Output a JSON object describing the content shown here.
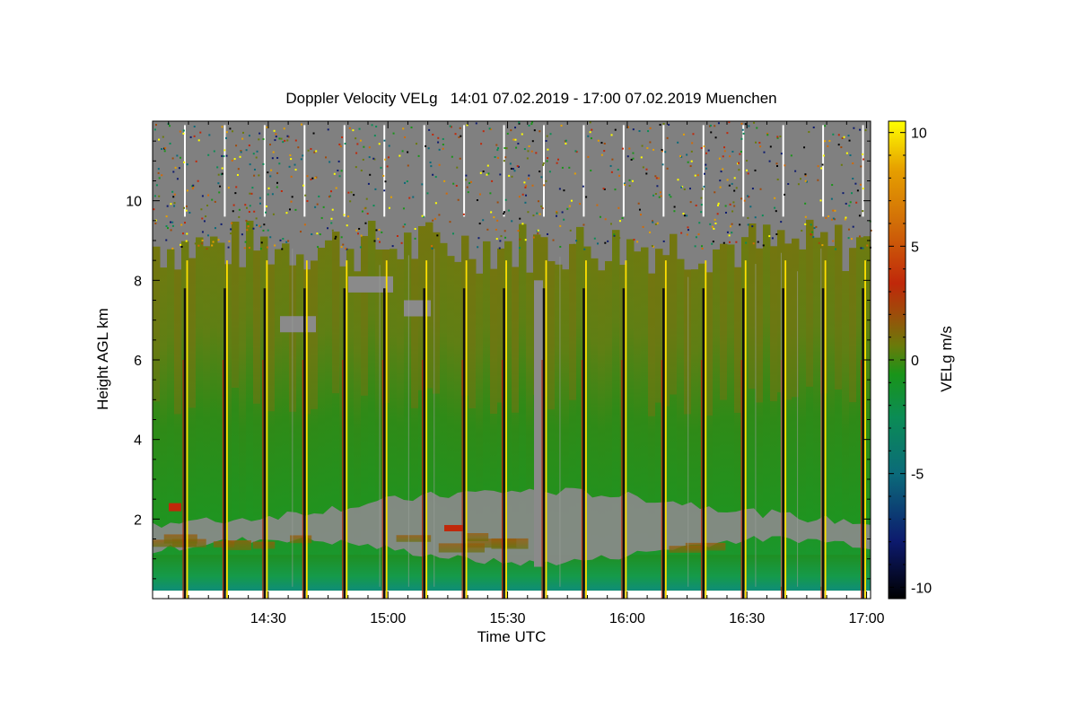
{
  "chart_data": {
    "type": "heatmap",
    "title": "Doppler Velocity VELg   14:01 07.02.2019 - 17:00 07.02.2019 Muenchen",
    "xlabel": "Time UTC",
    "ylabel": "Height AGL km",
    "colorbar_label": "VELg m/s",
    "x_range": [
      "14:01",
      "17:01"
    ],
    "x_ticks": [
      "14:30",
      "15:00",
      "15:30",
      "16:00",
      "16:30",
      "17:00"
    ],
    "ylim": [
      0,
      12
    ],
    "y_ticks": [
      2,
      4,
      6,
      8,
      10
    ],
    "color_range": [
      -10.5,
      10.5
    ],
    "colorbar_ticks": [
      10,
      5,
      0,
      -5,
      -10
    ],
    "colormap": [
      "#000000",
      "#0d1a6e",
      "#0b6a7a",
      "#0b8c55",
      "#199419",
      "#6a7a0a",
      "#a04a0a",
      "#c0280a",
      "#d06a08",
      "#e6a000",
      "#ffff00"
    ],
    "no_data_color": "#808080",
    "cloud_top_km_approx": 9.0,
    "grey_layer_km_approx": [
      1.2,
      2.3
    ],
    "velocity_in_cloud_approx": [
      -2,
      1
    ],
    "scan_interval_min": 10
  }
}
